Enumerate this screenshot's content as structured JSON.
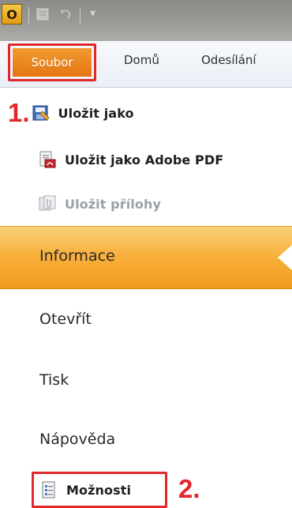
{
  "titlebar": {
    "app_icon_letter": "O"
  },
  "ribbon": {
    "file_tab_label": "Soubor",
    "tabs": [
      {
        "label": "Domů"
      },
      {
        "label": "Odesílání"
      }
    ]
  },
  "quick_commands": [
    {
      "label": "Uložit jako",
      "enabled": true,
      "step": "1."
    },
    {
      "label": "Uložit jako Adobe PDF",
      "enabled": true
    },
    {
      "label": "Uložit přílohy",
      "enabled": false
    }
  ],
  "menu": {
    "items": [
      {
        "label": "Informace",
        "active": true
      },
      {
        "label": "Otevřít"
      },
      {
        "label": "Tisk"
      },
      {
        "label": "Nápověda"
      }
    ],
    "options_label": "Možnosti",
    "options_step": "2."
  },
  "colors": {
    "accent_orange": "#f29a1e",
    "annotation_red": "#e1292b"
  }
}
